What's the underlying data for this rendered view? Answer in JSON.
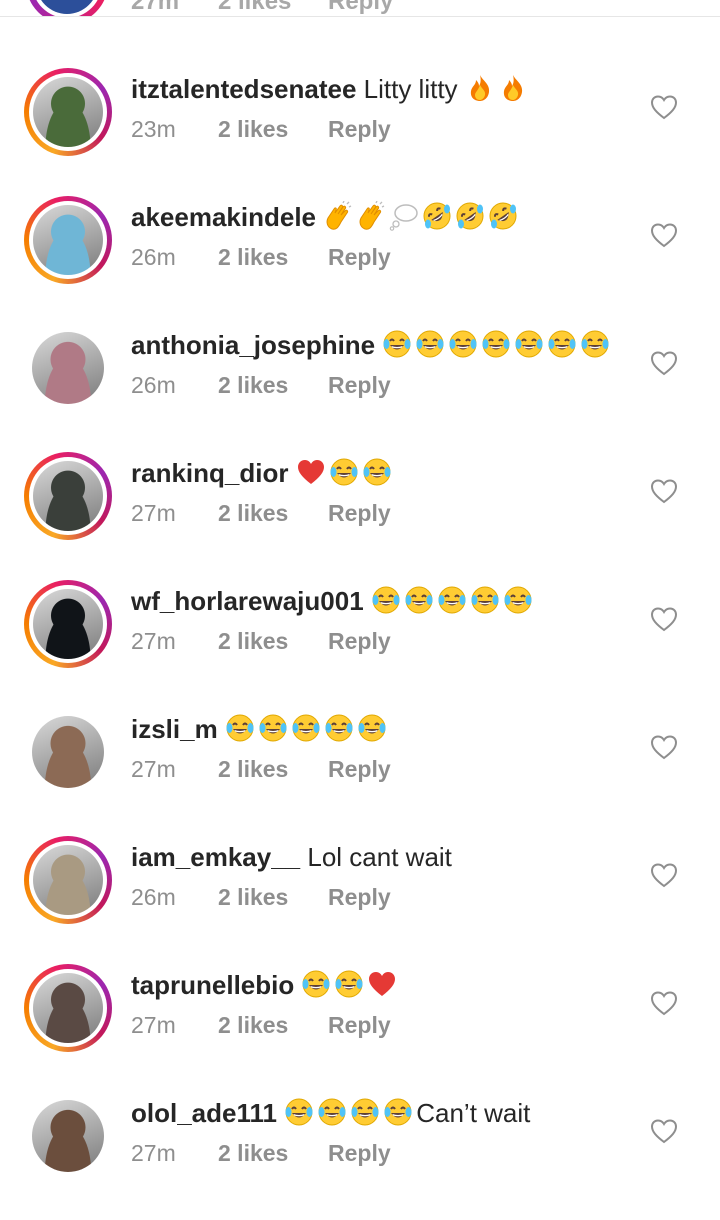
{
  "top_partial": {
    "time": "27m",
    "likes": "2 likes",
    "reply": "Reply"
  },
  "comments": [
    {
      "username": "itztalentedsenatee",
      "text": "Litty litty",
      "emojis": [
        "fire",
        "fire"
      ],
      "time": "23m",
      "likes": "2 likes",
      "reply": "Reply",
      "story_ring": true,
      "avatar_color": "#4a6b3a"
    },
    {
      "username": "akeemakindele",
      "text": "",
      "emojis": [
        "clap",
        "clap",
        "thought",
        "rofl",
        "rofl",
        "rofl"
      ],
      "time": "26m",
      "likes": "2 likes",
      "reply": "Reply",
      "story_ring": true,
      "avatar_color": "#6fb6d6"
    },
    {
      "username": "anthonia_josephine",
      "text": "",
      "emojis": [
        "joy",
        "joy",
        "joy",
        "joy",
        "joy",
        "joy",
        "joy"
      ],
      "time": "26m",
      "likes": "2 likes",
      "reply": "Reply",
      "story_ring": false,
      "avatar_color": "#b07a86"
    },
    {
      "username": "rankinq_dior",
      "text": "",
      "emojis": [
        "heart",
        "joy",
        "joy"
      ],
      "time": "27m",
      "likes": "2 likes",
      "reply": "Reply",
      "story_ring": true,
      "avatar_color": "#3a3f3a"
    },
    {
      "username": "wf_horlarewaju001",
      "text": "",
      "emojis": [
        "joy",
        "joy",
        "joy",
        "joy",
        "joy"
      ],
      "time": "27m",
      "likes": "2 likes",
      "reply": "Reply",
      "story_ring": true,
      "avatar_color": "#101418"
    },
    {
      "username": "izsli_m",
      "text": "",
      "emojis": [
        "joy",
        "joy",
        "joy",
        "joy",
        "joy"
      ],
      "time": "27m",
      "likes": "2 likes",
      "reply": "Reply",
      "story_ring": false,
      "avatar_color": "#8c6a55"
    },
    {
      "username": "iam_emkay__",
      "text": "Lol cant wait",
      "emojis": [],
      "time": "26m",
      "likes": "2 likes",
      "reply": "Reply",
      "story_ring": true,
      "avatar_color": "#a99a82"
    },
    {
      "username": "taprunellebio",
      "text": "",
      "emojis": [
        "joy",
        "joy",
        "heart"
      ],
      "time": "27m",
      "likes": "2 likes",
      "reply": "Reply",
      "story_ring": true,
      "avatar_color": "#5a4a44"
    },
    {
      "username": "olol_ade111",
      "text": "Can’t wait",
      "emojis": [
        "joy",
        "joy",
        "joy",
        "joy"
      ],
      "emojis_before_text": true,
      "time": "27m",
      "likes": "2 likes",
      "reply": "Reply",
      "story_ring": false,
      "avatar_color": "#6b4e3d"
    }
  ],
  "icons": {
    "like": "heart-outline-icon"
  },
  "colors": {
    "text": "#262626",
    "meta": "#8e8e8e",
    "heart_outline": "#8e8e8e"
  }
}
